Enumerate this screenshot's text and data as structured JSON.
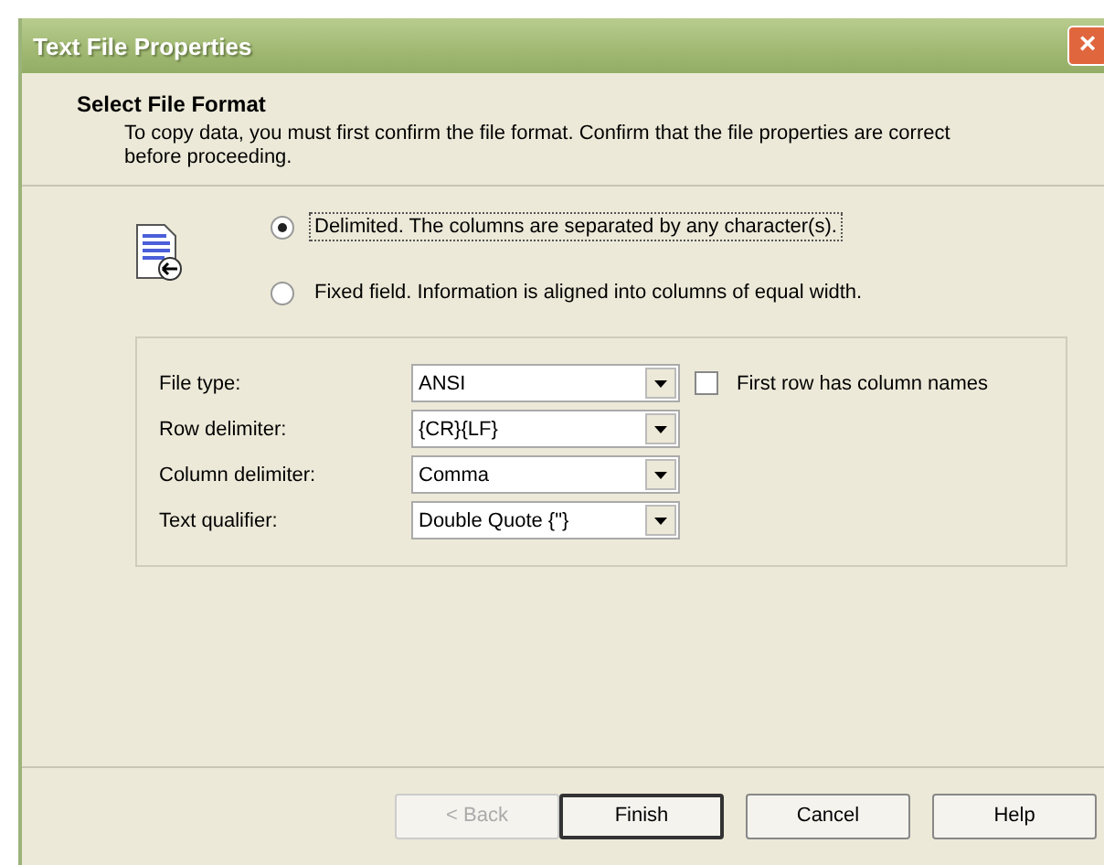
{
  "window": {
    "title": "Text File Properties",
    "close": "×"
  },
  "header": {
    "title": "Select File Format",
    "description": "To copy data, you must first confirm the file format. Confirm that the file properties are correct before proceeding."
  },
  "format_options": [
    {
      "label": "Delimited. The columns are separated by any character(s).",
      "selected": true
    },
    {
      "label": "Fixed field. Information is aligned into columns of equal width.",
      "selected": false
    }
  ],
  "fields": [
    {
      "label": "File type:",
      "value": "ANSI"
    },
    {
      "label": "Row delimiter:",
      "value": "{CR}{LF}"
    },
    {
      "label": "Column delimiter:",
      "value": "Comma"
    },
    {
      "label": "Text qualifier:",
      "value": "Double Quote {\"}"
    }
  ],
  "first_row_names": {
    "label": "First row has column names",
    "checked": false
  },
  "buttons": [
    {
      "label": "< Back",
      "disabled": true,
      "default": false
    },
    {
      "label": "Finish",
      "disabled": false,
      "default": true
    },
    {
      "label": "Cancel",
      "disabled": false,
      "default": false
    },
    {
      "label": "Help",
      "disabled": false,
      "default": false
    }
  ]
}
